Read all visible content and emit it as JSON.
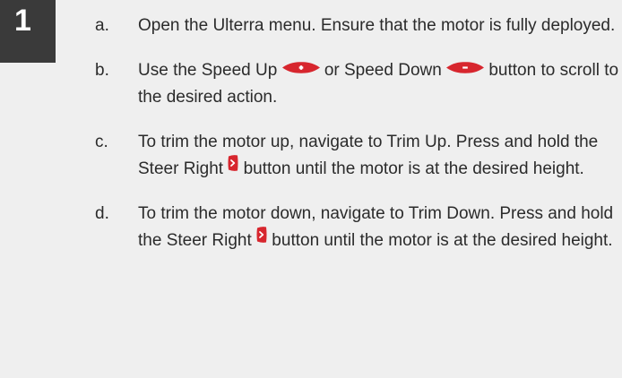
{
  "step_number": "1",
  "steps": [
    {
      "letter": "a.",
      "text": "Open the Ulterra menu. Ensure that the motor is fully deployed."
    },
    {
      "letter": "b.",
      "text_1": "Use the Speed Up ",
      "icon_1": "speed-up-button-icon",
      "text_2": " or Speed Down ",
      "icon_2": "speed-down-button-icon",
      "text_3": " button to scroll to the desired action."
    },
    {
      "letter": "c.",
      "text_1": "To trim the motor up, navigate to Trim Up. Press and hold the Steer Right ",
      "icon_1": "steer-right-button-icon",
      "text_2": " button until the motor is at the desired height."
    },
    {
      "letter": "d.",
      "text_1": "To trim the motor down, navigate to Trim Down. Press and hold the Steer Right ",
      "icon_1": "steer-right-button-icon",
      "text_2": " button until the motor is at the desired height."
    }
  ],
  "colors": {
    "background": "#efefef",
    "badge": "#3a3a3a",
    "button_red": "#d7262e",
    "text": "#2b2b2b"
  }
}
